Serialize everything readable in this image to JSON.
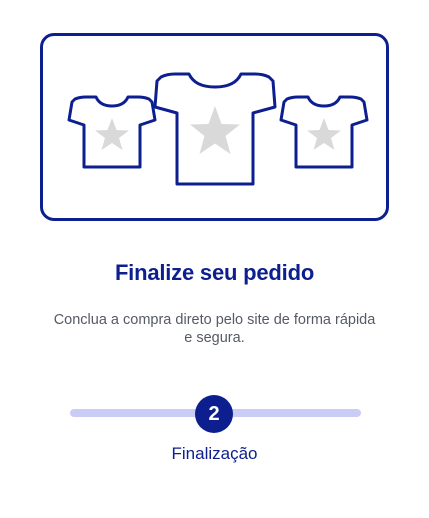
{
  "illustration": {
    "icons": [
      "tshirt-icon",
      "tshirt-icon",
      "tshirt-icon"
    ],
    "star_icon": "star-icon"
  },
  "content": {
    "title": "Finalize seu pedido",
    "subtitle": "Conclua a compra direto pelo site de forma rápida e segura."
  },
  "progress": {
    "current_step": "2",
    "step_label": "Finalização",
    "fill_fraction": 0.5
  },
  "colors": {
    "primary": "#0d1f8f",
    "track": "#c9cdf6",
    "star": "#d9d9d9",
    "text_muted": "#555a66"
  }
}
